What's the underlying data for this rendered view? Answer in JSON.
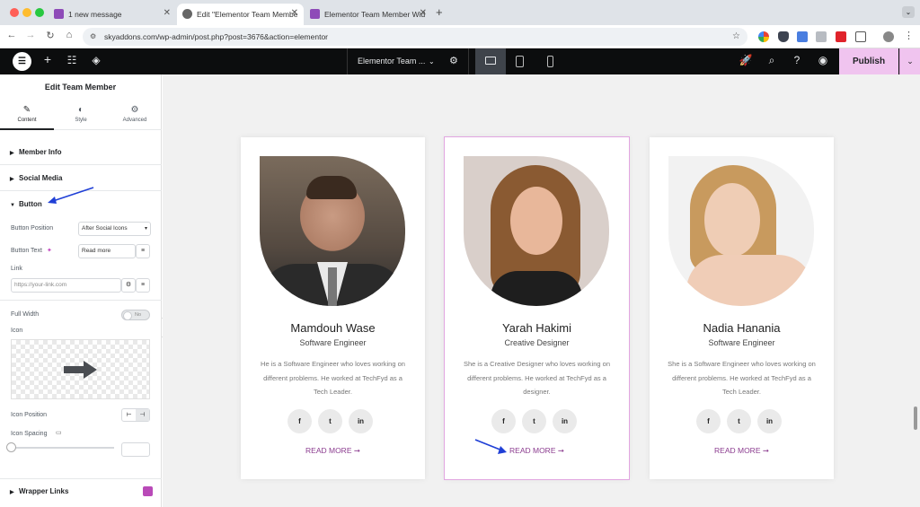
{
  "browser": {
    "tabs": [
      {
        "title": "1 new message",
        "fav_color": "#8e4bb8"
      },
      {
        "title": "Edit \"Elementor Team Membe",
        "fav_color": "#666666"
      },
      {
        "title": "Elementor Team Member Wid",
        "fav_color": "#8e4bb8"
      }
    ],
    "new_tab": "+",
    "url": "skyaddons.com/wp-admin/post.php?post=3676&action=elementor"
  },
  "topbar": {
    "document_name": "Elementor Team ...",
    "publish_label": "Publish"
  },
  "panel": {
    "title": "Edit Team Member",
    "tabs": [
      {
        "label": "Content",
        "icon": "pencil-icon"
      },
      {
        "label": "Style",
        "icon": "half-circle-icon"
      },
      {
        "label": "Advanced",
        "icon": "gear-icon"
      }
    ],
    "sections": {
      "member_info": "Member Info",
      "social_media": "Social Media",
      "button": "Button",
      "wrapper_links": "Wrapper Links"
    },
    "controls": {
      "button_position_label": "Button Position",
      "button_position_value": "After Social Icons",
      "button_text_label": "Button Text",
      "button_text_value": "Read more",
      "link_label": "Link",
      "link_placeholder": "https://your-link.com",
      "full_width_label": "Full Width",
      "full_width_value": "No",
      "icon_label": "Icon",
      "icon_position_label": "Icon Position",
      "icon_spacing_label": "Icon Spacing"
    }
  },
  "members": [
    {
      "name": "Mamdouh Wase",
      "role": "Software Engineer",
      "bio": "He is a Software Engineer who loves working on different problems. He worked at TechFyd as a Tech Leader.",
      "read_more": "READ MORE ➞",
      "socials": [
        "f",
        "t",
        "in"
      ]
    },
    {
      "name": "Yarah Hakimi",
      "role": "Creative Designer",
      "bio": "She is a Creative Designer who loves working on different problems. He worked at TechFyd as a designer.",
      "read_more": "READ MORE ➞",
      "socials": [
        "f",
        "t",
        "in"
      ]
    },
    {
      "name": "Nadia Hanania",
      "role": "Software Engineer",
      "bio": "She is a Software Engineer who loves working on different problems. He worked at TechFyd as a Tech Leader.",
      "read_more": "READ MORE ➞",
      "socials": [
        "f",
        "t",
        "in"
      ]
    }
  ],
  "colors": {
    "accent": "#8b3c8f",
    "publish_bg": "#f0c4ef",
    "annotation_arrow": "#1f3fd6"
  }
}
